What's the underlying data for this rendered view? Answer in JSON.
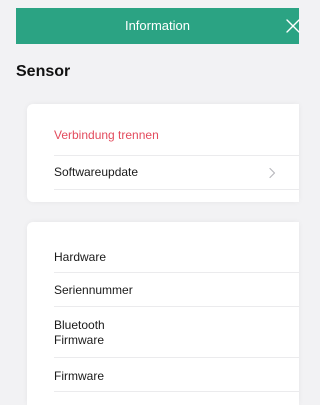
{
  "header": {
    "title": "Information",
    "close_icon": "close-icon"
  },
  "section": {
    "title": "Sensor"
  },
  "card_actions": {
    "disconnect_label": "Verbindung trennen",
    "software_update_label": "Softwareupdate",
    "chevron_icon": "chevron-right-icon"
  },
  "card_info": {
    "rows": [
      {
        "label": "Hardware"
      },
      {
        "label": "Seriennummer"
      },
      {
        "label": "Bluetooth\nFirmware"
      },
      {
        "label": "Firmware"
      }
    ]
  },
  "colors": {
    "header_bg": "#2ba383",
    "danger": "#e34b5d",
    "background": "#f2f2f4",
    "card": "#ffffff"
  }
}
